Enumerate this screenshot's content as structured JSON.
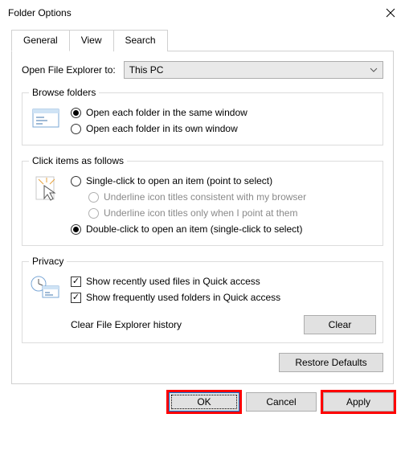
{
  "title": "Folder Options",
  "tabs": {
    "general": "General",
    "view": "View",
    "search": "Search"
  },
  "open_to": {
    "label": "Open File Explorer to:",
    "value": "This PC"
  },
  "browse": {
    "legend": "Browse folders",
    "same": "Open each folder in the same window",
    "own": "Open each folder in its own window"
  },
  "click": {
    "legend": "Click items as follows",
    "single": "Single-click to open an item (point to select)",
    "ul_browser": "Underline icon titles consistent with my browser",
    "ul_point": "Underline icon titles only when I point at them",
    "double": "Double-click to open an item (single-click to select)"
  },
  "privacy": {
    "legend": "Privacy",
    "recent_files": "Show recently used files in Quick access",
    "frequent_folders": "Show frequently used folders in Quick access",
    "clear_label": "Clear File Explorer history",
    "clear_btn": "Clear"
  },
  "restore_defaults": "Restore Defaults",
  "buttons": {
    "ok": "OK",
    "cancel": "Cancel",
    "apply": "Apply"
  }
}
